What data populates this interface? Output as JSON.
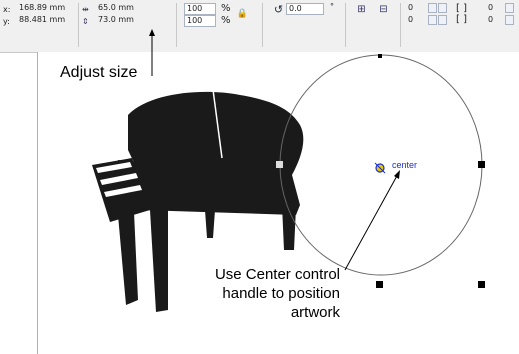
{
  "toolbar": {
    "x_label": "x:",
    "x_value": "168.89 mm",
    "y_label": "y:",
    "y_value": "88.481 mm",
    "width_value": "65.0 mm",
    "height_value": "73.0 mm",
    "scale_x": "100",
    "scale_y": "100",
    "pct1": "%",
    "pct2": "%",
    "rotation_value": "0.0",
    "degree": "°",
    "corner_tl": "0",
    "corner_bl": "0",
    "corner_tr": "0",
    "corner_br": "0"
  },
  "annotations": {
    "adjust_size": "Adjust size",
    "center_callout_1": "Use Center control",
    "center_callout_2": "handle to position",
    "center_callout_3": "artwork",
    "center_label": "center"
  },
  "colors": {
    "accent": "#1a2fd6",
    "piano": "#1a1a1a",
    "ellipse": "#666666"
  }
}
